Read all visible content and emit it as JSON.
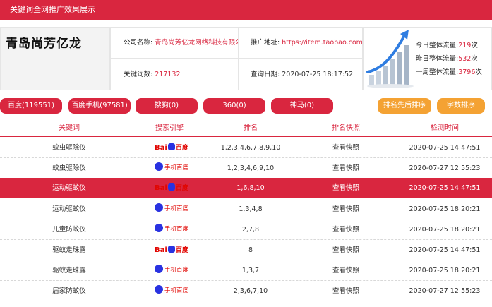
{
  "header": {
    "title": "关键词全网推广效果展示"
  },
  "company": {
    "name": "青岛尚芳亿龙",
    "name_label": "公司名称:",
    "name_value": "青岛尚芳亿龙网络科技有限公",
    "keywords_label": "关键词数:",
    "keywords_value": "217132",
    "url_label": "推广地址:",
    "url_value": "https://item.taobao.com/ite",
    "date_label": "查询日期:",
    "date_value": "2020-07-25 18:17:52"
  },
  "traffic": {
    "today_label": "今日整体流量:",
    "today_value": "219",
    "today_unit": "次",
    "yesterday_label": "昨日整体流量:",
    "yesterday_value": "532",
    "yesterday_unit": "次",
    "week_label": "一周整体流量:",
    "week_value": "3796",
    "week_unit": "次"
  },
  "engine_tabs": [
    {
      "label": "百度(119551)"
    },
    {
      "label": "百度手机(97581)"
    },
    {
      "label": "搜狗(0)"
    },
    {
      "label": "360(0)"
    },
    {
      "label": "神马(0)"
    }
  ],
  "sort_buttons": [
    {
      "label": "排名先后排序"
    },
    {
      "label": "字数排序"
    }
  ],
  "table": {
    "headers": [
      "关键词",
      "搜索引擎",
      "排名",
      "排名快照",
      "检测时间"
    ],
    "rows": [
      {
        "keyword": "蚊虫驱除仪",
        "engine": "baidu",
        "rank": "1,2,3,4,6,7,8,9,10",
        "snapshot": "查看快照",
        "time": "2020-07-25 14:47:51"
      },
      {
        "keyword": "蚊虫驱除仪",
        "engine": "baidu-mobile",
        "rank": "1,2,3,4,6,9,10",
        "snapshot": "查看快照",
        "time": "2020-07-27 12:55:23"
      },
      {
        "keyword": "运动驱蚊仪",
        "engine": "baidu",
        "rank": "1,6,8,10",
        "snapshot": "查看快照",
        "time": "2020-07-25 14:47:51"
      },
      {
        "keyword": "运动驱蚊仪",
        "engine": "baidu-mobile",
        "rank": "1,3,4,8",
        "snapshot": "查看快照",
        "time": "2020-07-25 18:20:21"
      },
      {
        "keyword": "儿童防蚊仪",
        "engine": "baidu-mobile",
        "rank": "2,7,8",
        "snapshot": "查看快照",
        "time": "2020-07-25 18:20:21"
      },
      {
        "keyword": "驱蚊走珠露",
        "engine": "baidu",
        "rank": "8",
        "snapshot": "查看快照",
        "time": "2020-07-25 14:47:51"
      },
      {
        "keyword": "驱蚊走珠露",
        "engine": "baidu-mobile",
        "rank": "1,3,7",
        "snapshot": "查看快照",
        "time": "2020-07-25 18:20:21"
      },
      {
        "keyword": "居家防蚊仪",
        "engine": "baidu-mobile",
        "rank": "2,3,6,7,10",
        "snapshot": "查看快照",
        "time": "2020-07-27 12:55:23"
      }
    ]
  },
  "logos": {
    "baidu_text_left": "Bai",
    "baidu_text_right": "百度",
    "baidu_mobile_text": "手机百度"
  },
  "colors": {
    "primary": "#d9263f",
    "accent": "#f4a233"
  }
}
